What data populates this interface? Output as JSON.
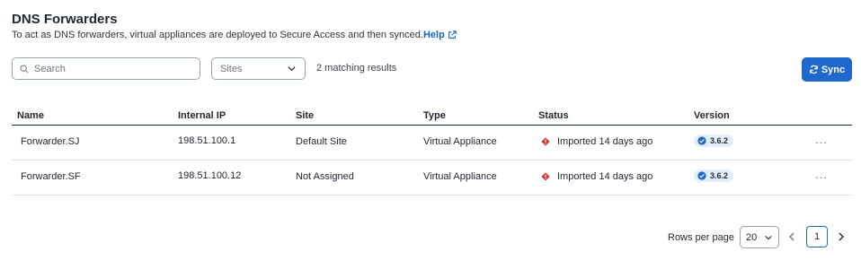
{
  "header": {
    "title": "DNS Forwarders",
    "subtitle": "To act as DNS forwarders, virtual appliances are deployed to Secure Access and then synced.",
    "help_label": "Help"
  },
  "toolbar": {
    "search_placeholder": "Search",
    "sites_placeholder": "Sites",
    "match_count": "2 matching results",
    "sync_label": "Sync"
  },
  "table": {
    "columns": [
      "Name",
      "Internal IP",
      "Site",
      "Type",
      "Status",
      "Version"
    ],
    "rows": [
      {
        "name": "Forwarder.SJ",
        "ip": "198.51.100.1",
        "site": "Default Site",
        "type": "Virtual Appliance",
        "status": "Imported 14 days ago",
        "version": "3.6.2",
        "actions": "..."
      },
      {
        "name": "Forwarder.SF",
        "ip": "198.51.100.12",
        "site": "Not Assigned",
        "type": "Virtual Appliance",
        "status": "Imported 14 days ago",
        "version": "3.6.2",
        "actions": "..."
      }
    ]
  },
  "pagination": {
    "rows_per_page_label": "Rows per page",
    "rows_per_page_value": "20",
    "current_page": "1"
  },
  "colors": {
    "primary": "#1d69cc",
    "link": "#1365b8",
    "error": "#d0323a",
    "badge_bg": "#e4eefa"
  }
}
